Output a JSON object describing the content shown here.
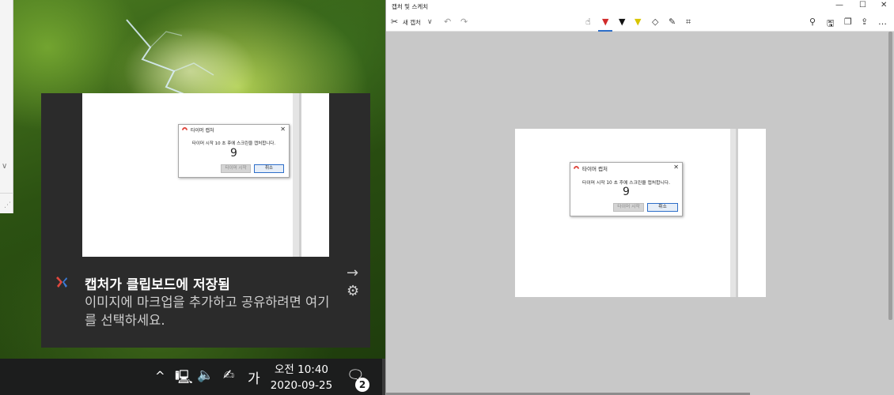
{
  "toast": {
    "title": "캡처가 클립보드에 저장됨",
    "body": "이미지에 마크업을 추가하고 공유하려면 여기를 선택하세요.",
    "arrow_icon": "→",
    "gear_icon": "⚙"
  },
  "capture_dialog": {
    "title": "타이머 캡처",
    "close": "✕",
    "message": "타이머 시작 10 초 후에 스크린을 캡처합니다.",
    "countdown": "9",
    "start_button": "타이머 시작",
    "cancel_button": "취소"
  },
  "taskbar": {
    "chevron": "^",
    "network_icon": "🖳",
    "volume_icon": "🔈",
    "pen_icon": "✍",
    "ime": "가",
    "clock_time": "오전 10:40",
    "clock_date": "2020-09-25",
    "notification_icon": "🗨",
    "notification_count": "2"
  },
  "snip": {
    "title": "캡처 및 스케치",
    "window_controls": {
      "minimize": "—",
      "maximize": "☐",
      "close": "✕"
    },
    "toolbar": {
      "new_icon": "✂",
      "new_label": "새 캡처",
      "new_chevron": "∨",
      "undo": "↶",
      "redo": "↷",
      "touch_writing": "☝",
      "ballpoint": "▼",
      "pencil": "▼",
      "highlighter": "▼",
      "eraser": "◇",
      "ruler": "✎",
      "crop": "⌗",
      "zoom": "⚲",
      "save": "🖫",
      "copy": "❐",
      "share": "⇪",
      "more": "…"
    }
  },
  "left_window": {
    "chevron": "∨",
    "grip": "⋰"
  },
  "colors": {
    "toast_bg": "#2b2b2b",
    "taskbar_bg": "#1c1d1d",
    "canvas_bg": "#c8c8c8",
    "accent": "#2d6ec9",
    "pen_red": "#d12a2a",
    "highlighter_yellow": "#d8c500"
  }
}
